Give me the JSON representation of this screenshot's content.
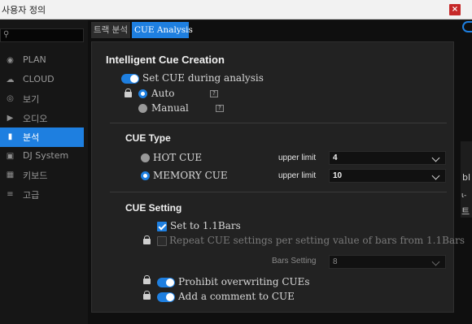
{
  "window": {
    "title": "사용자 정의",
    "close_label": "×"
  },
  "sidebar": {
    "search_placeholder": "",
    "items": [
      {
        "label": "PLAN",
        "icon": "globe-icon",
        "active": false
      },
      {
        "label": "CLOUD",
        "icon": "cloud-icon",
        "active": false
      },
      {
        "label": "보기",
        "icon": "eye-icon",
        "active": false
      },
      {
        "label": "오디오",
        "icon": "speaker-icon",
        "active": false
      },
      {
        "label": "분석",
        "icon": "waveform-icon",
        "active": true
      },
      {
        "label": "DJ System",
        "icon": "dj-system-icon",
        "active": false
      },
      {
        "label": "키보드",
        "icon": "keyboard-icon",
        "active": false
      },
      {
        "label": "고급",
        "icon": "menu-lines-icon",
        "active": false
      }
    ]
  },
  "tabs": [
    {
      "label": "트랙 분석",
      "active": false
    },
    {
      "label": "CUE Analysis",
      "active": true
    }
  ],
  "intelligent": {
    "title": "Intelligent Cue Creation",
    "set_cue_label": "Set CUE during analysis",
    "set_cue_on": true,
    "auto_label": "Auto",
    "manual_label": "Manual",
    "selected": "Auto",
    "help_glyph": "?"
  },
  "cue_type": {
    "title": "CUE Type",
    "hot_label": "HOT CUE",
    "memory_label": "MEMORY CUE",
    "selected": "MEMORY CUE",
    "upper_limit_label": "upper limit",
    "hot_limit": "4",
    "memory_limit": "10"
  },
  "cue_setting": {
    "title": "CUE Setting",
    "set_to_label": "Set to 1.1Bars",
    "set_to_checked": true,
    "repeat_label": "Repeat CUE settings per setting value of bars from 1.1Bars",
    "repeat_checked": false,
    "bars_setting_label": "Bars Setting",
    "bars_setting_value": "8",
    "prohibit_label": "Prohibit overwriting CUEs",
    "prohibit_on": true,
    "comment_label": "Add a comment to CUE",
    "comment_on": true
  },
  "right_edge": {
    "t1": "bl",
    "t2": "ι-",
    "t3": "트"
  },
  "colors": {
    "accent": "#1e7fe0",
    "panel": "#222222",
    "close": "#c62828"
  }
}
